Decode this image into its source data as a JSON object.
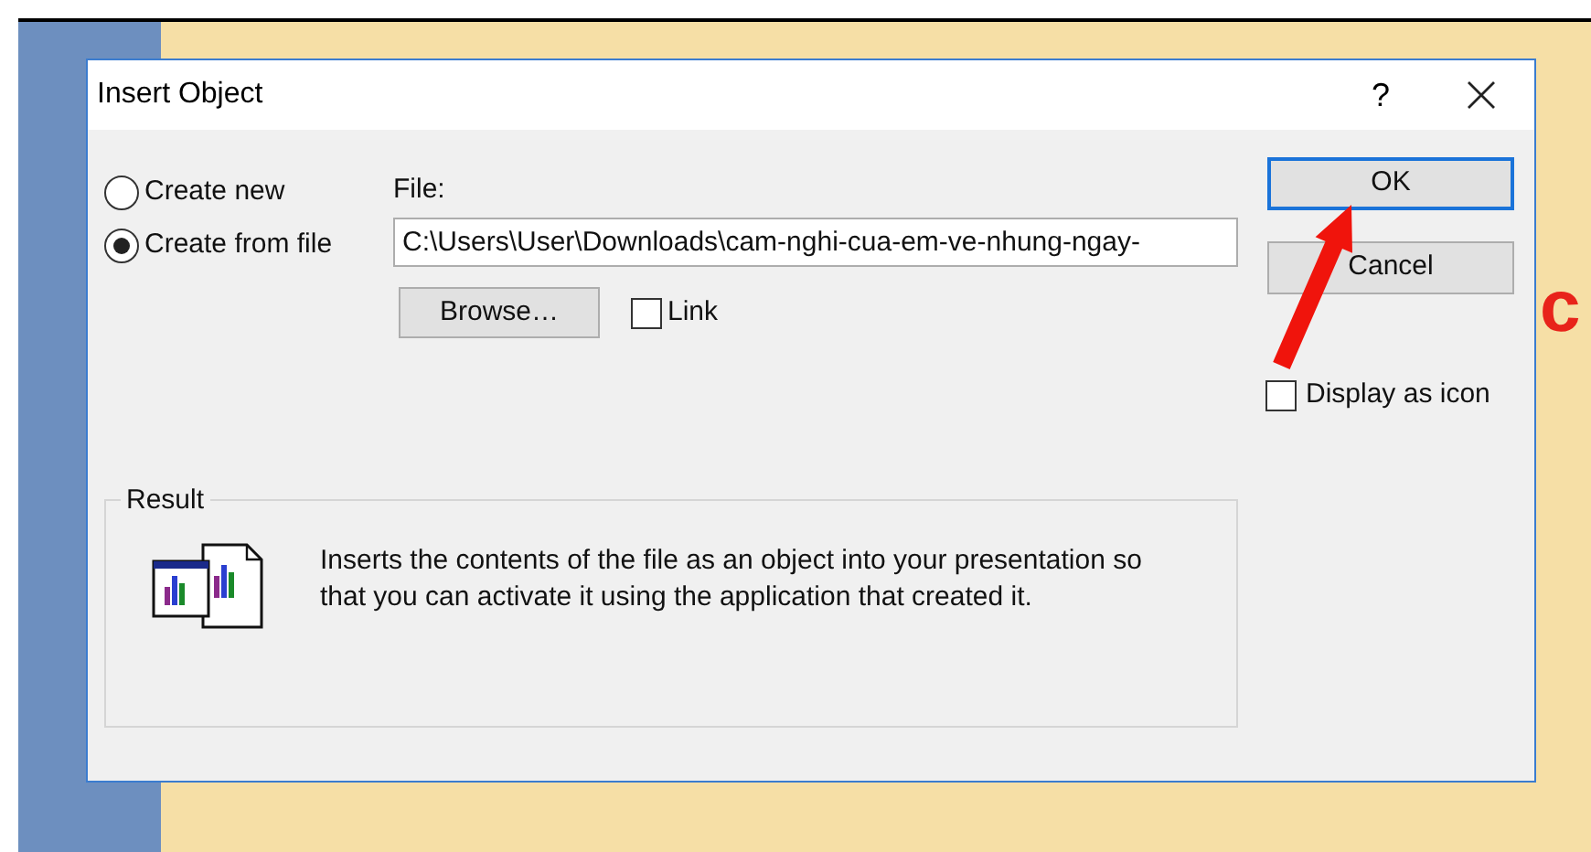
{
  "window": {
    "title": "Insert Object",
    "help_button": "?"
  },
  "options": [
    {
      "label": "Create new",
      "selected": false
    },
    {
      "label": "Create from file",
      "selected": true
    }
  ],
  "file": {
    "label": "File:",
    "value": "C:\\Users\\User\\Downloads\\cam-nghi-cua-em-ve-nhung-ngay-"
  },
  "browse_button": "Browse…",
  "link": {
    "label": "Link",
    "checked": false
  },
  "buttons": [
    {
      "label": "OK",
      "kind": "default"
    },
    {
      "label": "Cancel",
      "kind": "normal"
    }
  ],
  "display_as_icon": {
    "label": "Display as icon",
    "checked": false
  },
  "result": {
    "title": "Result",
    "text": "Inserts the contents of the file as an object into your presentation so that you can activate it using the application that created it."
  },
  "background": {
    "slide_text": "c"
  }
}
